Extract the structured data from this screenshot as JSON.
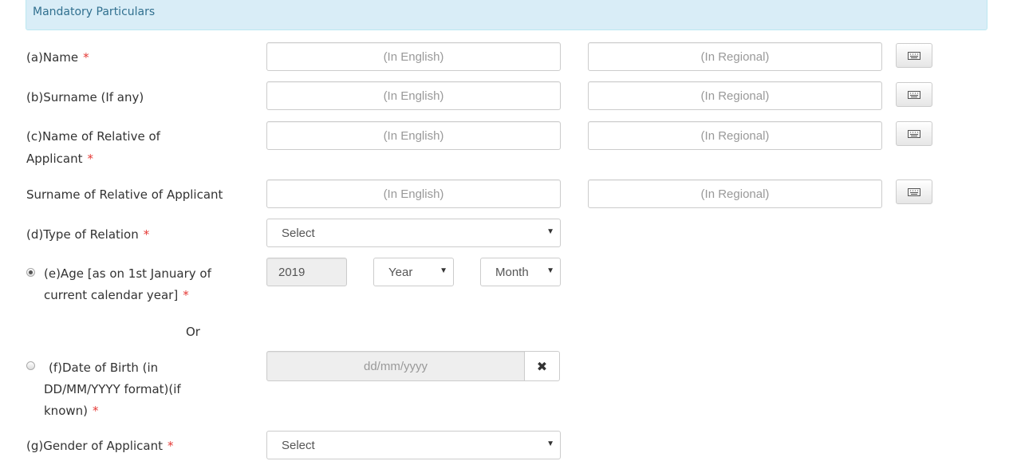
{
  "section": {
    "title": "Mandatory Particulars"
  },
  "required_mark": "*",
  "placeholders": {
    "english": "(In English)",
    "regional": "(In Regional)"
  },
  "fields": {
    "name": {
      "label": "(a)Name"
    },
    "surname": {
      "label": "(b)Surname (If any)"
    },
    "relative_name": {
      "label_line1": "(c)Name of Relative of",
      "label_line2": "Applicant"
    },
    "relative_surname": {
      "label": "Surname of Relative of Applicant"
    },
    "relation_type": {
      "label": "(d)Type of Relation",
      "selected": "Select"
    },
    "age": {
      "label_line1": "(e)Age [as on 1st January of",
      "label_line2": "current calendar year]",
      "year_value": "2019",
      "year_select": "Year",
      "month_select": "Month",
      "radio_checked": true
    },
    "or_text": "Or",
    "dob": {
      "label_line1": "(f)Date of Birth (in",
      "label_line2": "DD/MM/YYYY format)(if",
      "label_line3": "known)",
      "placeholder": "dd/mm/yyyy",
      "clear_icon": "close-icon",
      "clear_symbol": "✖",
      "radio_checked": false
    },
    "gender": {
      "label": "(g)Gender of Applicant",
      "selected": "Select"
    }
  },
  "icons": {
    "keyboard": "keyboard-icon",
    "dropdown": "caret-down-icon",
    "dropdown_symbol": "▼"
  },
  "colors": {
    "banner_bg": "#d9edf7",
    "banner_text": "#31708f",
    "required": "#e53935"
  }
}
